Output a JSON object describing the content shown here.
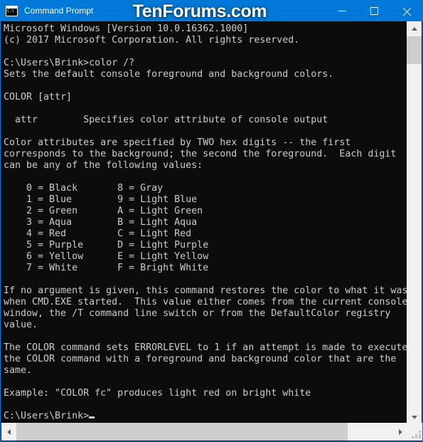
{
  "window": {
    "title": "Command Prompt",
    "icon": "console-icon",
    "icon_prompt_text": "C:\\",
    "accent_color": "#0078d7",
    "console_bg": "#0c0c0c",
    "console_fg": "#cccccc"
  },
  "watermark": {
    "text": "TenForums.com"
  },
  "titlebar_buttons": {
    "minimize_label": "—",
    "maximize_label": "□",
    "close_label": "✕"
  },
  "console": {
    "text": "Microsoft Windows [Version 10.0.16362.1000]\n(c) 2017 Microsoft Corporation. All rights reserved.\n\nC:\\Users\\Brink>color /?\nSets the default console foreground and background colors.\n\nCOLOR [attr]\n\n  attr        Specifies color attribute of console output\n\nColor attributes are specified by TWO hex digits -- the first\ncorresponds to the background; the second the foreground.  Each digit\ncan be any of the following values:\n\n    0 = Black       8 = Gray\n    1 = Blue        9 = Light Blue\n    2 = Green       A = Light Green\n    3 = Aqua        B = Light Aqua\n    4 = Red         C = Light Red\n    5 = Purple      D = Light Purple\n    6 = Yellow      E = Light Yellow\n    7 = White       F = Bright White\n\nIf no argument is given, this command restores the color to what it was\nwhen CMD.EXE started.  This value either comes from the current console\nwindow, the /T command line switch or from the DefaultColor registry\nvalue.\n\nThe COLOR command sets ERRORLEVEL to 1 if an attempt is made to execute\nthe COLOR command with a foreground and background color that are the\nsame.\n\nExample: \"COLOR fc\" produces light red on bright white\n\nC:\\Users\\Brink>",
    "prompt": "C:\\Users\\Brink>",
    "command": "color /?",
    "color_table": [
      {
        "code": "0",
        "name": "Black",
        "code2": "8",
        "name2": "Gray"
      },
      {
        "code": "1",
        "name": "Blue",
        "code2": "9",
        "name2": "Light Blue"
      },
      {
        "code": "2",
        "name": "Green",
        "code2": "A",
        "name2": "Light Green"
      },
      {
        "code": "3",
        "name": "Aqua",
        "code2": "B",
        "name2": "Light Aqua"
      },
      {
        "code": "4",
        "name": "Red",
        "code2": "C",
        "name2": "Light Red"
      },
      {
        "code": "5",
        "name": "Purple",
        "code2": "D",
        "name2": "Light Purple"
      },
      {
        "code": "6",
        "name": "Yellow",
        "code2": "E",
        "name2": "Light Yellow"
      },
      {
        "code": "7",
        "name": "White",
        "code2": "F",
        "name2": "Bright White"
      }
    ]
  },
  "scrollbars": {
    "vertical": {
      "up_arrow": "▲",
      "down_arrow": "▼"
    },
    "horizontal": {
      "left_arrow": "◀",
      "right_arrow": "▶"
    }
  }
}
